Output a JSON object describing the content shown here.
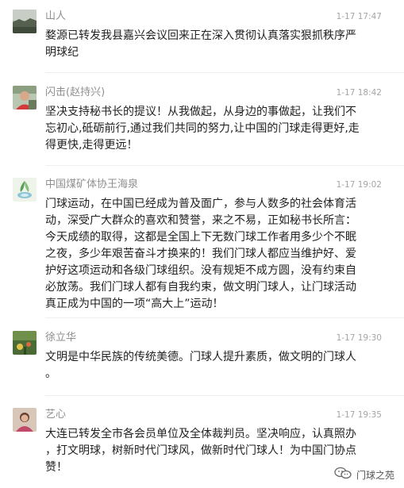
{
  "comments": [
    {
      "name": "山人",
      "time": "1-17 17:47",
      "lines": [
        "婺源已转发我县嘉兴会议回来正在深入贯彻认真落实狠抓秩序严",
        "明球纪"
      ]
    },
    {
      "name": "闪击(赵持兴)",
      "time": "1-17 18:42",
      "lines": [
        "坚决支持秘书长的提议！从我做起，从身边的事做起，让我们不",
        "忘初心,砥砺前行,通过我们共同的努力,让中国的门球走得更好,走",
        "得更快,走得更远！"
      ]
    },
    {
      "name": "中国煤矿体协王海泉",
      "time": "1-17 19:02",
      "lines": [
        "门球运动，在中国已经成为普及面广，参与人数多的社会体育活",
        "动，深受广大群众的喜欢和赞誉，来之不易，正如秘书长所言：",
        "今天成绩的取得，这都是全国上下无数门球工作者用多少个不眠",
        "之夜，多少年艰苦奋斗才换来的！我们门球人都应当维护好、爱",
        "护好这项运动和各级门球组织。没有规矩不成方圆，没有约束自",
        "必放荡。我们门球人都有自我约束，做文明门球人，让门球活动",
        "真正成为中国的一项“高大上”运动！"
      ]
    },
    {
      "name": "徐立华",
      "time": "1-17 19:30",
      "lines": [
        "文明是中华民族的传统美德。门球人提升素质，做文明的门球人",
        "。"
      ]
    },
    {
      "name": "艺心",
      "time": "1-17 19:35",
      "lines": [
        "大连已转发全市各会员单位及全体裁判员。坚决响应，认真照办",
        "，打文明球，树新时代门球风，做新时代门球人！为中国门协点",
        "赞！"
      ]
    }
  ],
  "watermark": {
    "text": "门球之苑",
    "icon": "wechat-channel-icon"
  }
}
